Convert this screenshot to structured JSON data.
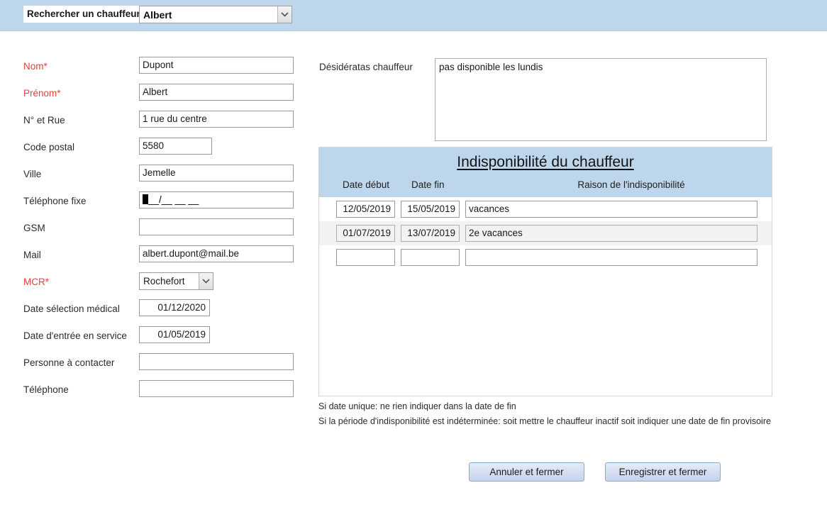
{
  "search": {
    "label": "Rechercher un chauffeur",
    "value": "Albert",
    "arrow_icon": "chevron-down-icon"
  },
  "form": {
    "fields": [
      {
        "label": "Nom*",
        "value": "Dupont",
        "required": true,
        "type": "text"
      },
      {
        "label": "Prénom*",
        "value": "Albert",
        "required": true,
        "type": "text"
      },
      {
        "label": "N° et Rue",
        "value": "1 rue du centre",
        "required": false,
        "type": "text"
      },
      {
        "label": "Code postal",
        "value": "5580",
        "required": false,
        "type": "text-short"
      },
      {
        "label": "Ville",
        "value": "Jemelle",
        "required": false,
        "type": "text"
      },
      {
        "label": "Téléphone fixe",
        "value": "__/__ __ __",
        "required": false,
        "type": "mask"
      },
      {
        "label": "GSM",
        "value": "",
        "required": false,
        "type": "text"
      },
      {
        "label": "Mail",
        "value": "albert.dupont@mail.be",
        "required": false,
        "type": "text"
      },
      {
        "label": "MCR*",
        "value": "Rochefort",
        "required": true,
        "type": "combo"
      },
      {
        "label": "Date sélection médical",
        "value": "01/12/2020",
        "required": false,
        "type": "date"
      },
      {
        "label": "Date d'entrée en service",
        "value": "01/05/2019",
        "required": false,
        "type": "date"
      },
      {
        "label": "Personne à contacter",
        "value": "",
        "required": false,
        "type": "text"
      },
      {
        "label": "Téléphone",
        "value": "",
        "required": false,
        "type": "text"
      }
    ]
  },
  "wishes": {
    "label": "Désidératas chauffeur",
    "value": "pas disponible les lundis"
  },
  "unavailability": {
    "title": "Indisponibilité du chauffeur",
    "columns": {
      "start": "Date début",
      "end": "Date fin",
      "reason": "Raison de l'indisponibilité"
    },
    "rows": [
      {
        "start": "12/05/2019",
        "end": "15/05/2019",
        "reason": "vacances"
      },
      {
        "start": "01/07/2019",
        "end": "13/07/2019",
        "reason": "2e vacances"
      },
      {
        "start": "",
        "end": "",
        "reason": ""
      }
    ]
  },
  "notes": [
    "Si date unique: ne rien indiquer dans la date de fin",
    "Si la période d'indisponibilité est indéterminée: soit mettre le chauffeur inactif soit indiquer une date de fin provisoire"
  ],
  "buttons": {
    "cancel": "Annuler et fermer",
    "save": "Enregistrer et fermer"
  },
  "colors": {
    "band": "#bed6ec",
    "required": "#e8413a",
    "alt_row": "#f2f2f2",
    "button": "#c5d3ec"
  }
}
